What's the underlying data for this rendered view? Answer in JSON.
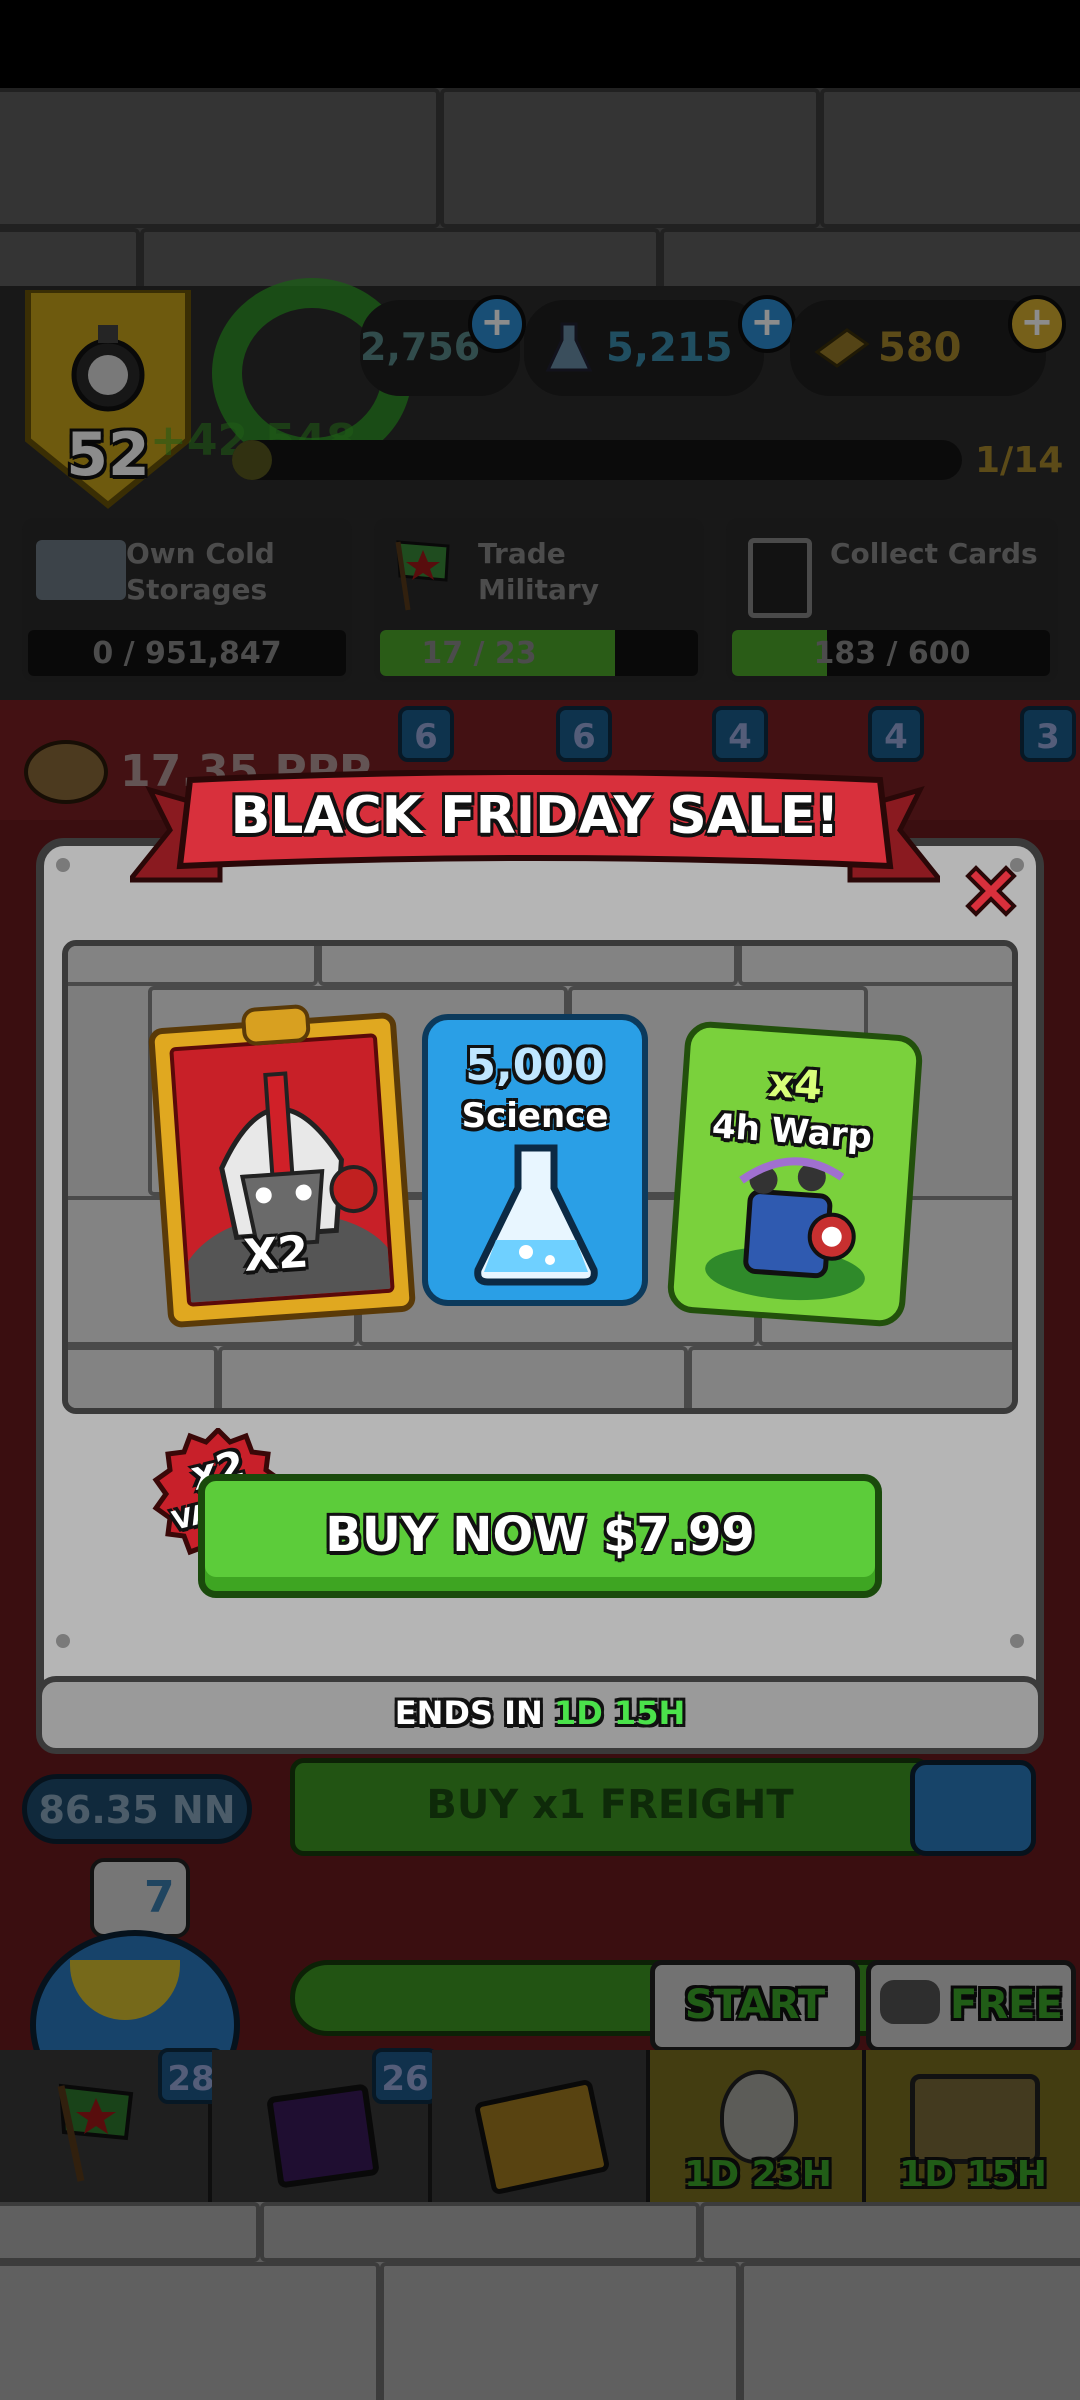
{
  "hud": {
    "level": "52",
    "currency_1": "2,756",
    "science_amount": "5,215",
    "bucks_amount": "580",
    "goal_progress_text": "1/14",
    "faded_income": "+42,548"
  },
  "goals": [
    {
      "label": "Own Cold Storages",
      "progress": "0 / 951,847",
      "fill": 0
    },
    {
      "label": "Trade Military",
      "progress": "17 / 23",
      "fill": 0.74
    },
    {
      "label": "Collect Cards",
      "progress": "183 / 600",
      "fill": 0.3
    }
  ],
  "shelf_badges": [
    "6",
    "6",
    "4",
    "4",
    "3"
  ],
  "background_money": "17.35 PPP",
  "popup": {
    "title": "BLACK FRIDAY SALE!",
    "card_item": {
      "multiplier": "X2"
    },
    "science_item": {
      "amount": "5,000",
      "label": "Science"
    },
    "warp_item": {
      "multiplier": "x4",
      "label": "4h Warp"
    },
    "value_badge": {
      "multiplier": "x2",
      "label": "VALUE"
    },
    "buy_button": "BUY NOW $7.99",
    "ends_label": "ENDS IN",
    "ends_days": "1D",
    "ends_hours": "15H"
  },
  "lower": {
    "balance": "86.35 NN",
    "freight_button": "BUY x1 FREIGHT",
    "science_cost": "7",
    "start_label": "START",
    "free_label": "FREE",
    "nav_badge_1": "28",
    "nav_badge_2": "26",
    "timer_1": "1D 23H",
    "timer_2": "1D 15H"
  },
  "colors": {
    "sale_red": "#d8303c",
    "buy_green": "#5ccc3a",
    "science_blue": "#2a9fe6",
    "warp_green": "#7ad13c",
    "ends_green": "#4be24b"
  }
}
